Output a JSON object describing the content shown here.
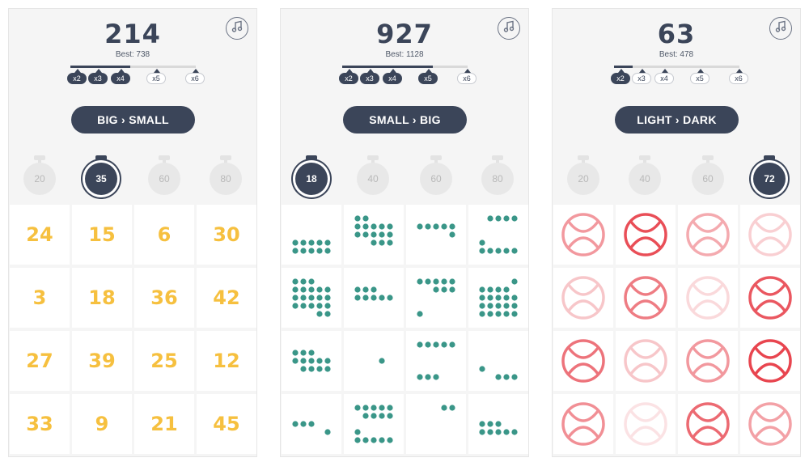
{
  "panels": [
    {
      "score": "214",
      "best": "Best: 738",
      "progress_fraction": 0.48,
      "multipliers": [
        {
          "label": "x2",
          "active": true
        },
        {
          "label": "x3",
          "active": true
        },
        {
          "label": "x4",
          "active": true
        },
        {
          "label": "x5",
          "active": false
        },
        {
          "label": "x6",
          "active": false
        }
      ],
      "mode_label": "BIG › SMALL",
      "timers": [
        {
          "label": "20",
          "selected": false
        },
        {
          "label": "35",
          "selected": true
        },
        {
          "label": "60",
          "selected": false
        },
        {
          "label": "80",
          "selected": false
        }
      ],
      "tiles_type": "numbers",
      "tiles": [
        "24",
        "15",
        "6",
        "30",
        "3",
        "18",
        "36",
        "42",
        "27",
        "39",
        "25",
        "12",
        "33",
        "9",
        "21",
        "45"
      ]
    },
    {
      "score": "927",
      "best": "Best: 1128",
      "progress_fraction": 0.72,
      "multipliers": [
        {
          "label": "x2",
          "active": true
        },
        {
          "label": "x3",
          "active": true
        },
        {
          "label": "x4",
          "active": true
        },
        {
          "label": "x5",
          "active": true
        },
        {
          "label": "x6",
          "active": false
        }
      ],
      "mode_label": "SMALL › BIG",
      "timers": [
        {
          "label": "18",
          "selected": true
        },
        {
          "label": "40",
          "selected": false
        },
        {
          "label": "60",
          "selected": false
        },
        {
          "label": "80",
          "selected": false
        }
      ],
      "tiles_type": "dots",
      "tiles": [
        10,
        15,
        6,
        10,
        20,
        8,
        9,
        20,
        12,
        1,
        8,
        4,
        4,
        15,
        2,
        8
      ]
    },
    {
      "score": "63",
      "best": "Best: 478",
      "progress_fraction": 0.15,
      "multipliers": [
        {
          "label": "x2",
          "active": true
        },
        {
          "label": "x3",
          "active": false
        },
        {
          "label": "x4",
          "active": false
        },
        {
          "label": "x5",
          "active": false
        },
        {
          "label": "x6",
          "active": false
        }
      ],
      "mode_label": "LIGHT › DARK",
      "timers": [
        {
          "label": "20",
          "selected": false
        },
        {
          "label": "40",
          "selected": false
        },
        {
          "label": "60",
          "selected": false
        },
        {
          "label": "72",
          "selected": true
        }
      ],
      "tiles_type": "shades",
      "tiles": [
        0.55,
        0.95,
        0.45,
        0.25,
        0.3,
        0.7,
        0.2,
        0.9,
        0.75,
        0.3,
        0.55,
        1.0,
        0.6,
        0.15,
        0.8,
        0.5
      ]
    }
  ],
  "colors": {
    "accent": "#3b4559",
    "number": "#f6c03f",
    "dots": "#3a9688",
    "shade": "#e8454f"
  },
  "icons": {
    "music": "music-note-icon",
    "timer": "stopwatch-icon"
  }
}
